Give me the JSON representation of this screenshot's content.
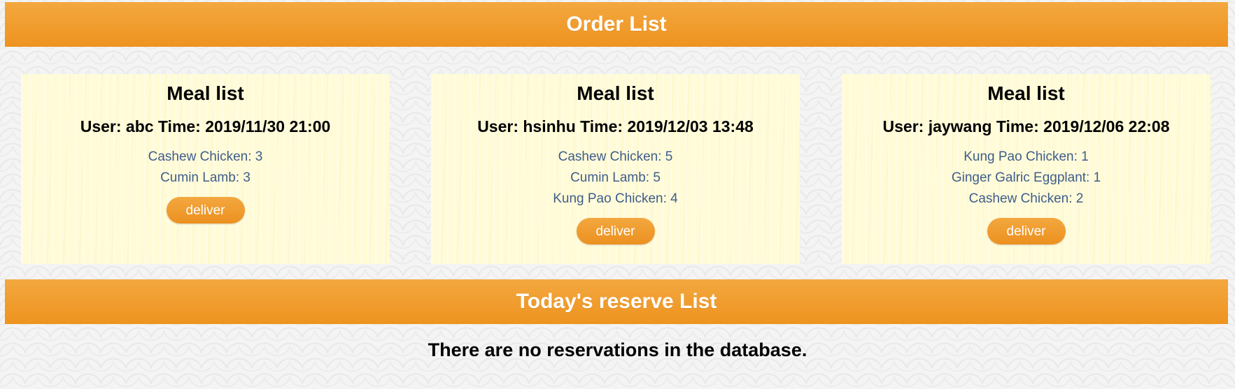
{
  "order_section": {
    "title": "Order List"
  },
  "orders": [
    {
      "title": "Meal list",
      "user_time": "User: abc Time: 2019/11/30 21:00",
      "items": [
        "Cashew Chicken: 3",
        "Cumin Lamb: 3"
      ],
      "button": "deliver"
    },
    {
      "title": "Meal list",
      "user_time": "User: hsinhu Time: 2019/12/03 13:48",
      "items": [
        "Cashew Chicken: 5",
        "Cumin Lamb: 5",
        "Kung Pao Chicken: 4"
      ],
      "button": "deliver"
    },
    {
      "title": "Meal list",
      "user_time": "User: jaywang Time: 2019/12/06 22:08",
      "items": [
        "Kung Pao Chicken: 1",
        "Ginger Galric Eggplant: 1",
        "Cashew Chicken: 2"
      ],
      "button": "deliver"
    }
  ],
  "reserve_section": {
    "title": "Today's reserve List",
    "empty_message": "There are no reservations in the database."
  },
  "colors": {
    "banner": "#ef9a2a",
    "card_bg": "#fffbd6",
    "item_text": "#3f5d8a",
    "button": "#ee9320"
  }
}
